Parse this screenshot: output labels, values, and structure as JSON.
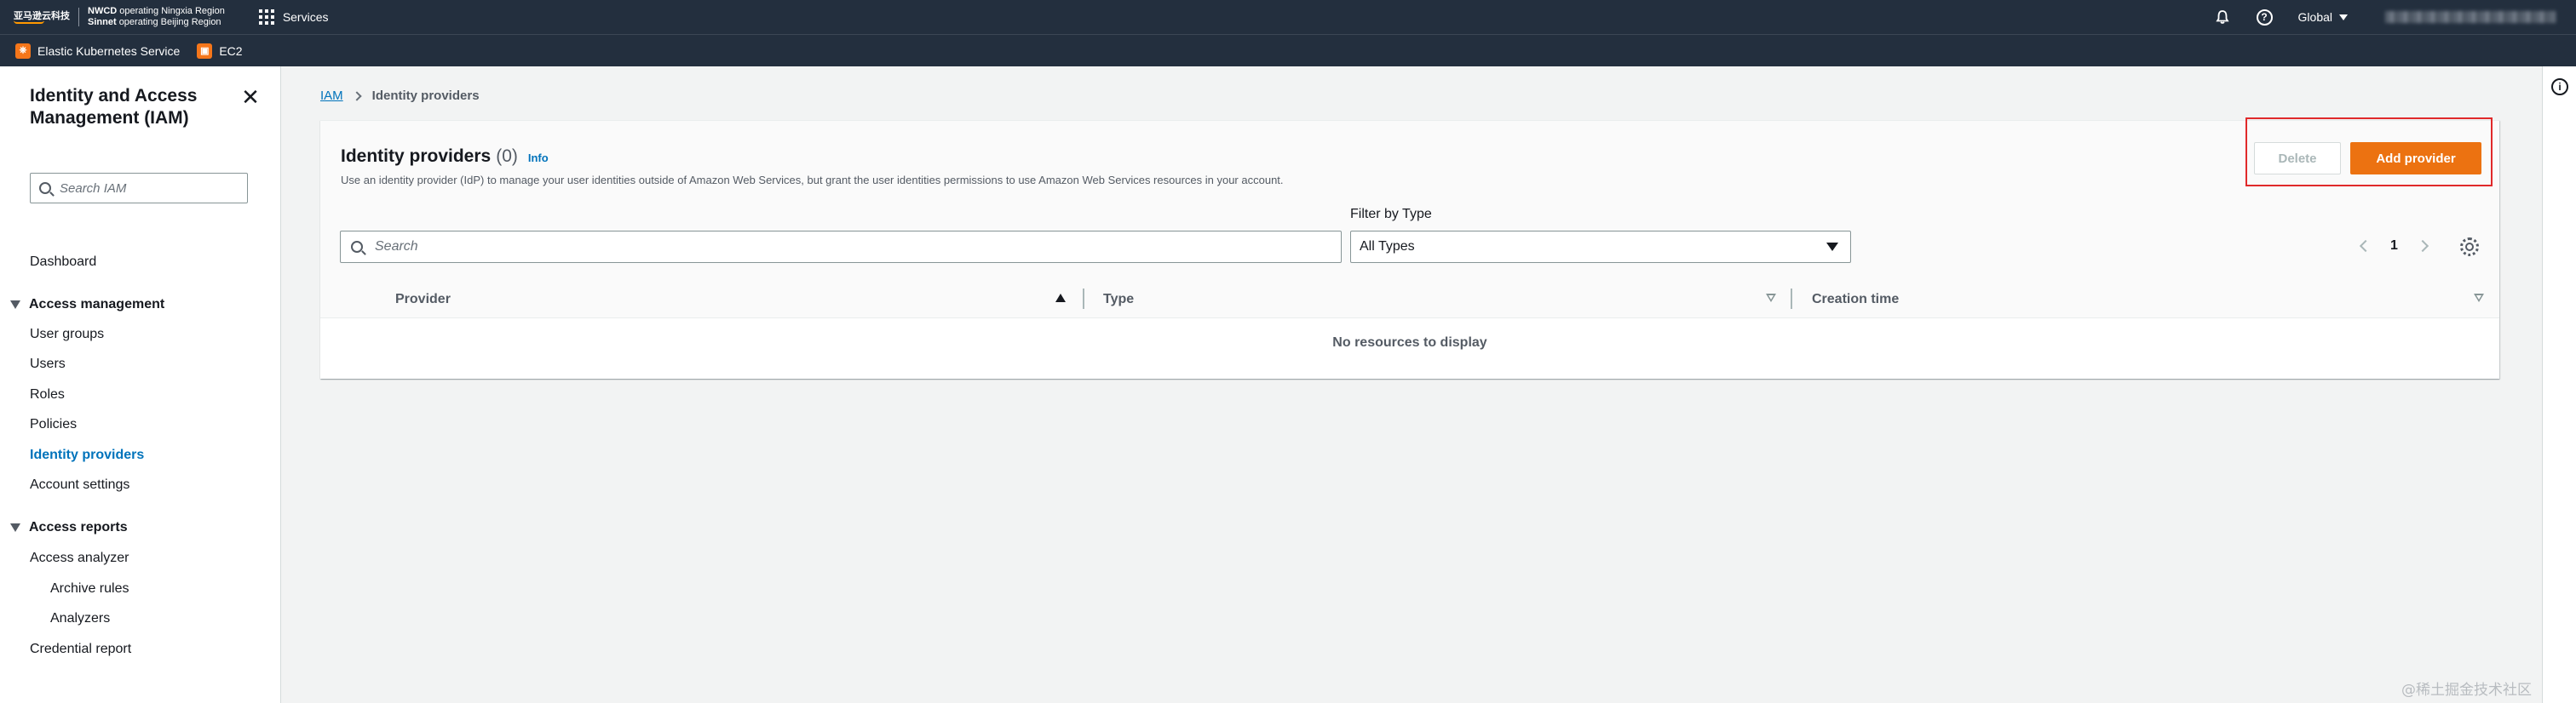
{
  "topnav": {
    "logo_text": "亚马逊云科技",
    "region_line1_bold": "NWCD",
    "region_line1": "operating Ningxia Region",
    "region_line2_bold": "Sinnet",
    "region_line2": "operating Beijing Region",
    "services_label": "Services",
    "help_glyph": "?",
    "global_label": "Global"
  },
  "favorites": [
    {
      "label": "Elastic Kubernetes Service",
      "icon": "eks-icon"
    },
    {
      "label": "EC2",
      "icon": "ec2-icon"
    }
  ],
  "sidebar": {
    "title": "Identity and Access Management (IAM)",
    "close_glyph": "✕",
    "search_placeholder": "Search IAM",
    "dashboard": "Dashboard",
    "access_management": {
      "label": "Access management",
      "items": [
        "User groups",
        "Users",
        "Roles",
        "Policies",
        "Identity providers",
        "Account settings"
      ],
      "active": "Identity providers"
    },
    "access_reports": {
      "label": "Access reports",
      "analyzer": "Access analyzer",
      "analyzer_children": [
        "Archive rules",
        "Analyzers"
      ],
      "credential_report": "Credential report"
    }
  },
  "breadcrumb": {
    "root": "IAM",
    "current": "Identity providers"
  },
  "panel": {
    "title": "Identity providers",
    "count": "(0)",
    "info_label": "Info",
    "description": "Use an identity provider (IdP) to manage your user identities outside of Amazon Web Services, but grant the user identities permissions to use Amazon Web Services resources in your account.",
    "delete_label": "Delete",
    "add_label": "Add provider",
    "search_placeholder": "Search",
    "filter_label": "Filter by Type",
    "filter_value": "All Types",
    "page_number": "1",
    "columns": [
      "Provider",
      "Type",
      "Creation time"
    ],
    "empty_text": "No resources to display",
    "highlight_color": "#e0292a"
  },
  "rail": {
    "info_glyph": "i"
  },
  "watermark": "@稀土掘金技术社区",
  "colors": {
    "nav_bg": "#232f3e",
    "primary_button": "#ec7211",
    "link": "#0073bb"
  }
}
